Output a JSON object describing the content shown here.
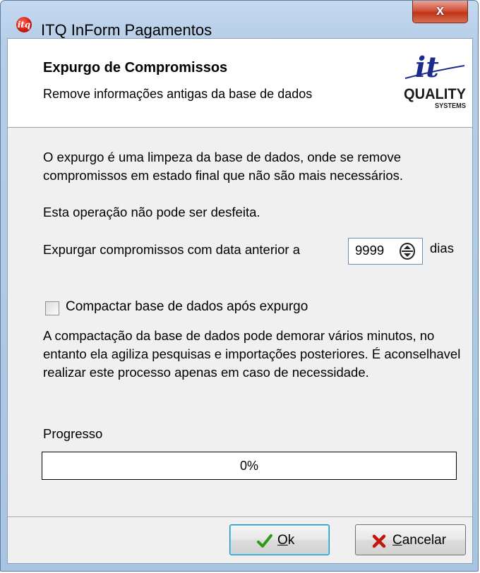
{
  "window": {
    "title": "ITQ InForm Pagamentos",
    "app_icon": "itq-app-icon",
    "close_label": "x"
  },
  "header": {
    "title": "Expurgo de Compromissos",
    "subtitle": "Remove informações antigas da base de dados",
    "logo": {
      "text_top": "it",
      "text_main": "QUALITY",
      "text_sub": "SYSTEMS",
      "icon": "it-quality-systems-logo"
    }
  },
  "body": {
    "description": "O expurgo é uma limpeza da base de dados, onde se remove compromissos em estado final que não são mais necessários.",
    "warning": "Esta operação não pode ser desfeita.",
    "expurge_prefix": "Expurgar compromissos com data anterior a",
    "days_value": "9999",
    "days_unit": "dias",
    "compact_label": "Compactar base de dados após expurgo",
    "compact_checked": false,
    "compact_note": "A compactação da base de dados pode demorar vários minutos, no entanto ela agiliza pesquisas e importações posteriores.  É aconselhavel realizar este processo apenas em caso de necessidade."
  },
  "progress": {
    "label": "Progresso",
    "value_text": "0%",
    "value": 0
  },
  "buttons": {
    "ok_label": "Ok",
    "cancel_label": "Cancelar"
  },
  "colors": {
    "ok_check": "#2e9a16",
    "cancel_x": "#c4150c",
    "close_button": "#c7432a"
  }
}
